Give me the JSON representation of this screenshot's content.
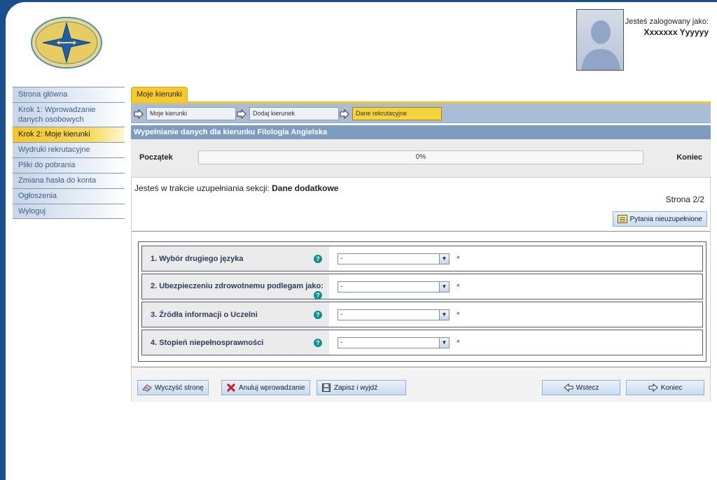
{
  "header": {
    "login_label": "Jesteś zalogowany jako:",
    "user_name": "Xxxxxxx Yyyyyy"
  },
  "sidebar": {
    "items": [
      {
        "label": "Strona główna",
        "active": false
      },
      {
        "label": "Krok 1: Wprowadzanie danych osobowych",
        "active": false
      },
      {
        "label": "Krok 2: Moje kierunki",
        "active": true
      },
      {
        "label": "Wydruki rekrutacyjne",
        "active": false
      },
      {
        "label": "Pliki do pobrania",
        "active": false
      },
      {
        "label": "Zmiana hasła do konta",
        "active": false
      },
      {
        "label": "Ogłoszenia",
        "active": false
      },
      {
        "label": "Wyloguj",
        "active": false
      }
    ]
  },
  "main": {
    "tab": "Moje kierunki",
    "breadcrumb": [
      "Moje kierunki",
      "Dodaj kierunek",
      "Dane rekrutacyjne"
    ],
    "section_title": "Wypełnianie danych dla kierunku Filologia Angielska",
    "progress": {
      "start_label": "Początek",
      "end_label": "Koniec",
      "value_text": "0%",
      "fraction": 0
    },
    "status_prefix": "Jesteś w trakcie uzupełniania sekcji:",
    "status_section": "Dane dodatkowe",
    "page_label": "Strona 2/2",
    "missing_button": "Pytania nieuzupełnione",
    "questions": [
      {
        "label": "1. Wybór drugiego języka",
        "value": "-",
        "required": "*"
      },
      {
        "label": "2. Ubezpieczeniu zdrowotnemu podlegam jako:",
        "value": "-",
        "required": "*"
      },
      {
        "label": "3. Źródła informacji o Uczelni",
        "value": "-",
        "required": "*"
      },
      {
        "label": "4. Stopień niepełnosprawności",
        "value": "-",
        "required": "*"
      }
    ],
    "help_glyph": "?",
    "buttons": {
      "clear": "Wyczyść stronę",
      "cancel": "Anuluj wprowadzanie",
      "save_exit": "Zapisz i wyjdź",
      "back": "Wstecz",
      "finish": "Koniec"
    }
  },
  "colors": {
    "accent_blue": "#7d9cc2",
    "active_yellow": "#f6c92e",
    "background": "#1b4f8c",
    "help_icon": "#0f8f8f"
  }
}
